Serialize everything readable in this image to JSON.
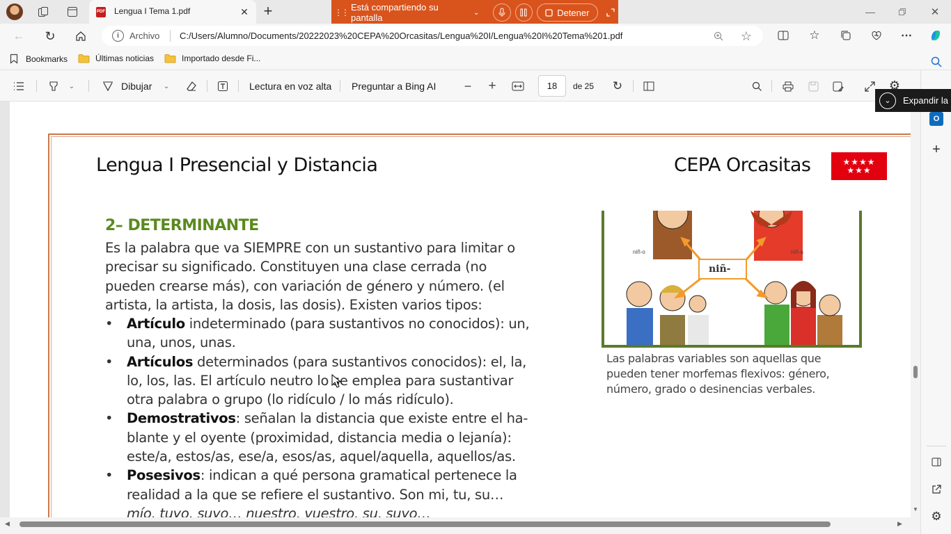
{
  "tab": {
    "title": "Lengua I Tema 1.pdf"
  },
  "share_bar": {
    "text": "Está compartiendo su pantalla",
    "stop_label": "Detener"
  },
  "address": {
    "label": "Archivo",
    "url": "C:/Users/Alumno/Documents/20222023%20CEPA%20Orcasitas/Lengua%20I/Lengua%20I%20Tema%201.pdf"
  },
  "bookmarks": [
    {
      "label": "Bookmarks",
      "icon": "bookmark-icon"
    },
    {
      "label": "Últimas noticias",
      "icon": "folder-icon"
    },
    {
      "label": "Importado desde Fi...",
      "icon": "folder-icon"
    }
  ],
  "pdf_toolbar": {
    "draw_label": "Dibujar",
    "read_aloud_label": "Lectura en voz alta",
    "ask_bing_label": "Preguntar a Bing AI",
    "page_number": "18",
    "page_total": "de 25"
  },
  "popup": {
    "label": "Expandir la"
  },
  "document": {
    "header_left": "Lengua I Presencial y Distancia",
    "header_right": "CEPA Orcasitas",
    "section_title": "2– DETERMINANTE",
    "intro_lines": [
      "Es la palabra que va SIEMPRE con un sustantivo para limitar o",
      "precisar su significado. Constituyen una clase cerrada (no",
      "pueden crearse más), con variación de género y número. (el",
      "artista, la artista, la dosis, las dosis). Existen varios tipos:"
    ],
    "bullets": [
      {
        "term": "Artículo",
        "lines": [
          " indeterminado (para sustantivos no conocidos): un,",
          "una, unos, unas."
        ]
      },
      {
        "term": "Artículos",
        "lines": [
          " determinados (para sustantivos conocidos): el, la,",
          "lo, los, las. El artículo neutro lo se emplea para sustantivar",
          "otra palabra o grupo (lo ridículo / lo más ridículo)."
        ]
      },
      {
        "term": "Demostrativos",
        "lines": [
          ": señalan la distancia que existe entre el ha-",
          "blante y el oyente (proximidad, distancia media o lejanía):",
          "este/a, estos/as, ese/a, esos/as, aquel/aquella, aquellos/as."
        ]
      },
      {
        "term": "Posesivos",
        "lines": [
          ": indican a qué persona gramatical pertenece la",
          "realidad a la que se refiere el sustantivo. Son mi, tu, su…",
          "mío, tuyo, suyo… nuestro, vuestro, su, suyo…"
        ]
      }
    ],
    "figure": {
      "center_label": "niñ-",
      "left_label": "niñ-o",
      "right_label": "niñ-a",
      "caption_lines": [
        "Las palabras variables son aquellas que",
        "pueden tener morfemas flexivos: género,",
        "número, grado o desinencias verbales."
      ]
    }
  },
  "colors": {
    "accent_orange": "#d9531c",
    "section_green": "#5a8a1e",
    "flag_red": "#e3000f",
    "frame_border": "#c8794a"
  }
}
